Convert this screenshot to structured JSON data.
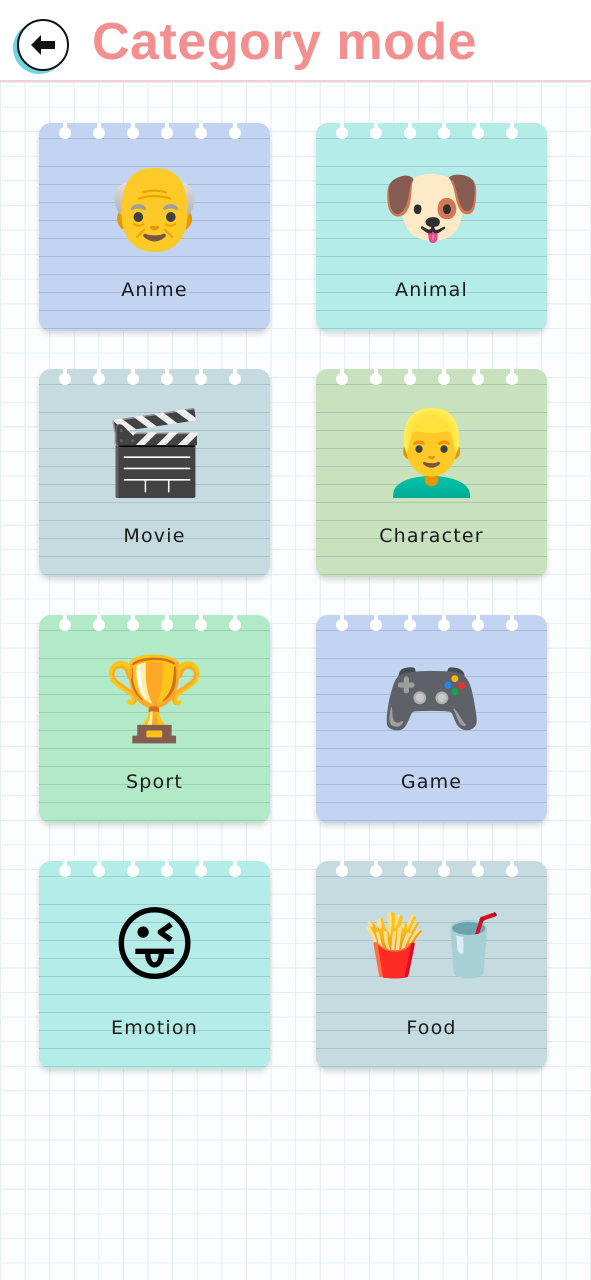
{
  "header": {
    "title": "Category mode",
    "back_icon": "arrow-left-icon"
  },
  "categories": [
    {
      "label": "Anime",
      "emoji": "👴",
      "color": "#c3d3f2"
    },
    {
      "label": "Animal",
      "emoji": "🐶",
      "color": "#b4ece8"
    },
    {
      "label": "Movie",
      "emoji": "🎬",
      "color": "#c6dbe0"
    },
    {
      "label": "Character",
      "emoji": "👱‍♂️",
      "color": "#c7e2bd"
    },
    {
      "label": "Sport",
      "emoji": "🏆",
      "color": "#b2e9c7"
    },
    {
      "label": "Game",
      "emoji": "🎮",
      "color": "#c3d3f2"
    },
    {
      "label": "Emotion",
      "emoji": "😜",
      "color": "#b4ece8"
    },
    {
      "label": "Food",
      "emoji": "🍟🥤",
      "color": "#c6dbe0"
    }
  ]
}
